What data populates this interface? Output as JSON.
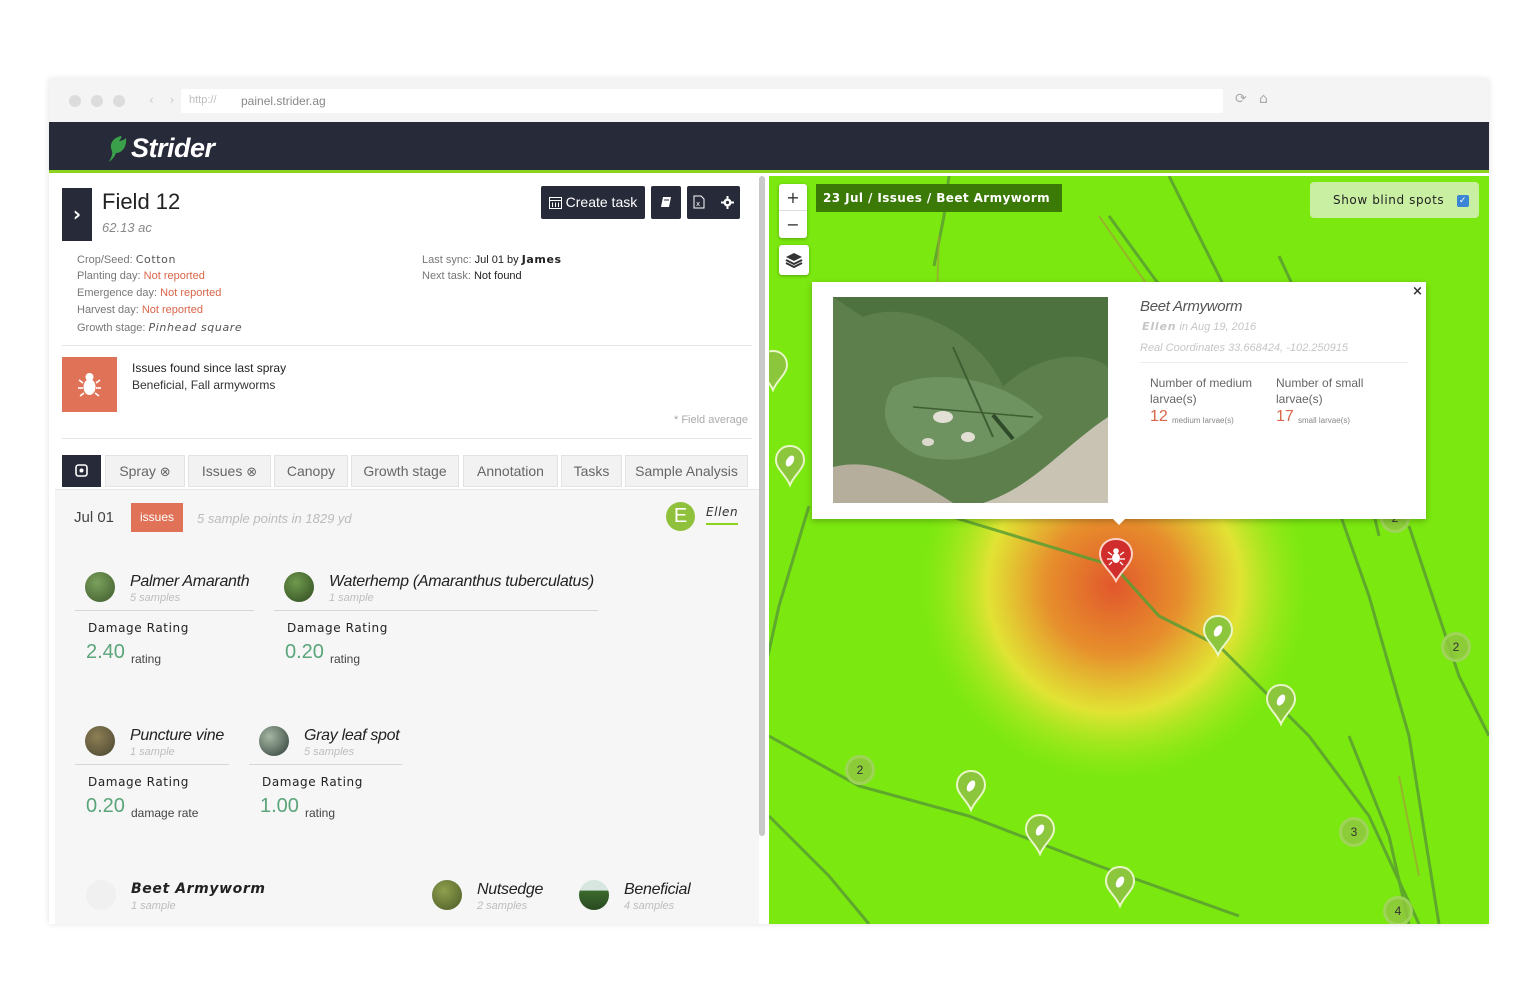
{
  "browser": {
    "protocol": "http://",
    "url": "painel.strider.ag",
    "nav_arrows": "‹ ›"
  },
  "app": {
    "brand": "Strider",
    "brand_color": "#8bd31f",
    "header_color": "#272a38"
  },
  "field": {
    "title": "Field 12",
    "area": "62.13 ac",
    "create_task_label": "Create task",
    "crop_label": "Crop/Seed:",
    "crop_value": "Cotton",
    "planting_label": "Planting day:",
    "planting_value": "Not reported",
    "emergence_label": "Emergence day:",
    "emergence_value": "Not reported",
    "harvest_label": "Harvest day:",
    "harvest_value": "Not reported",
    "growth_label": "Growth stage:",
    "growth_value": "Pinhead square",
    "last_sync_label": "Last sync:",
    "last_sync_value": "Jul 01 by",
    "last_sync_user": "James",
    "next_task_label": "Next task:",
    "next_task_value": "Not found",
    "issues_title": "Issues found since last spray",
    "issues_list": "Beneficial, Fall armyworms",
    "field_average_note": "* Field average"
  },
  "tabs": [
    {
      "label": "Spray",
      "closable": true
    },
    {
      "label": "Issues",
      "closable": true
    },
    {
      "label": "Canopy",
      "closable": false
    },
    {
      "label": "Growth stage",
      "closable": false
    },
    {
      "label": "Annotation",
      "closable": false
    },
    {
      "label": "Tasks",
      "closable": false
    },
    {
      "label": "Sample Analysis",
      "closable": false
    }
  ],
  "tab_close_glyph": "⊗",
  "report": {
    "date": "Jul 01",
    "badge": "issues",
    "summary": "5 sample points in 1829 yd",
    "user_initial": "E",
    "user_name": "Ellen"
  },
  "observations": [
    {
      "name": "Palmer Amaranth",
      "samples": "5 samples",
      "metric": "Damage Rating",
      "value": "2.40",
      "unit": "rating"
    },
    {
      "name": "Waterhemp (Amaranthus tuberculatus)",
      "samples": "1 sample",
      "metric": "Damage Rating",
      "value": "0.20",
      "unit": "rating"
    },
    {
      "name": "Puncture vine",
      "samples": "1 sample",
      "metric": "Damage Rating",
      "value": "0.20",
      "unit": "damage rate"
    },
    {
      "name": "Gray leaf spot",
      "samples": "5 samples",
      "metric": "Damage Rating",
      "value": "1.00",
      "unit": "rating"
    },
    {
      "name": "Beet Armyworm",
      "samples": "1 sample"
    },
    {
      "name": "Nutsedge",
      "samples": "2 samples"
    },
    {
      "name": "Beneficial",
      "samples": "4 samples"
    }
  ],
  "map": {
    "breadcrumb": "23 Jul / Issues / Beet Armyworm",
    "blind_spots_label": "Show blind spots",
    "blind_spots_checked": true,
    "zoom_in": "+",
    "zoom_out": "−",
    "cluster_labels": [
      "2",
      "2",
      "2",
      "3",
      "4"
    ]
  },
  "popup": {
    "title": "Beet Armyworm",
    "author": "Ellen",
    "date_text": "in Aug 19, 2016",
    "coords_label": "Real Coordinates",
    "coords_value": "33.668424, -102.250915",
    "close_glyph": "×",
    "metrics": [
      {
        "label": "Number of medium larvae(s)",
        "value": "12",
        "unit": "medium larvae(s)"
      },
      {
        "label": "Number of small larvae(s)",
        "value": "17",
        "unit": "small larvae(s)"
      }
    ]
  }
}
